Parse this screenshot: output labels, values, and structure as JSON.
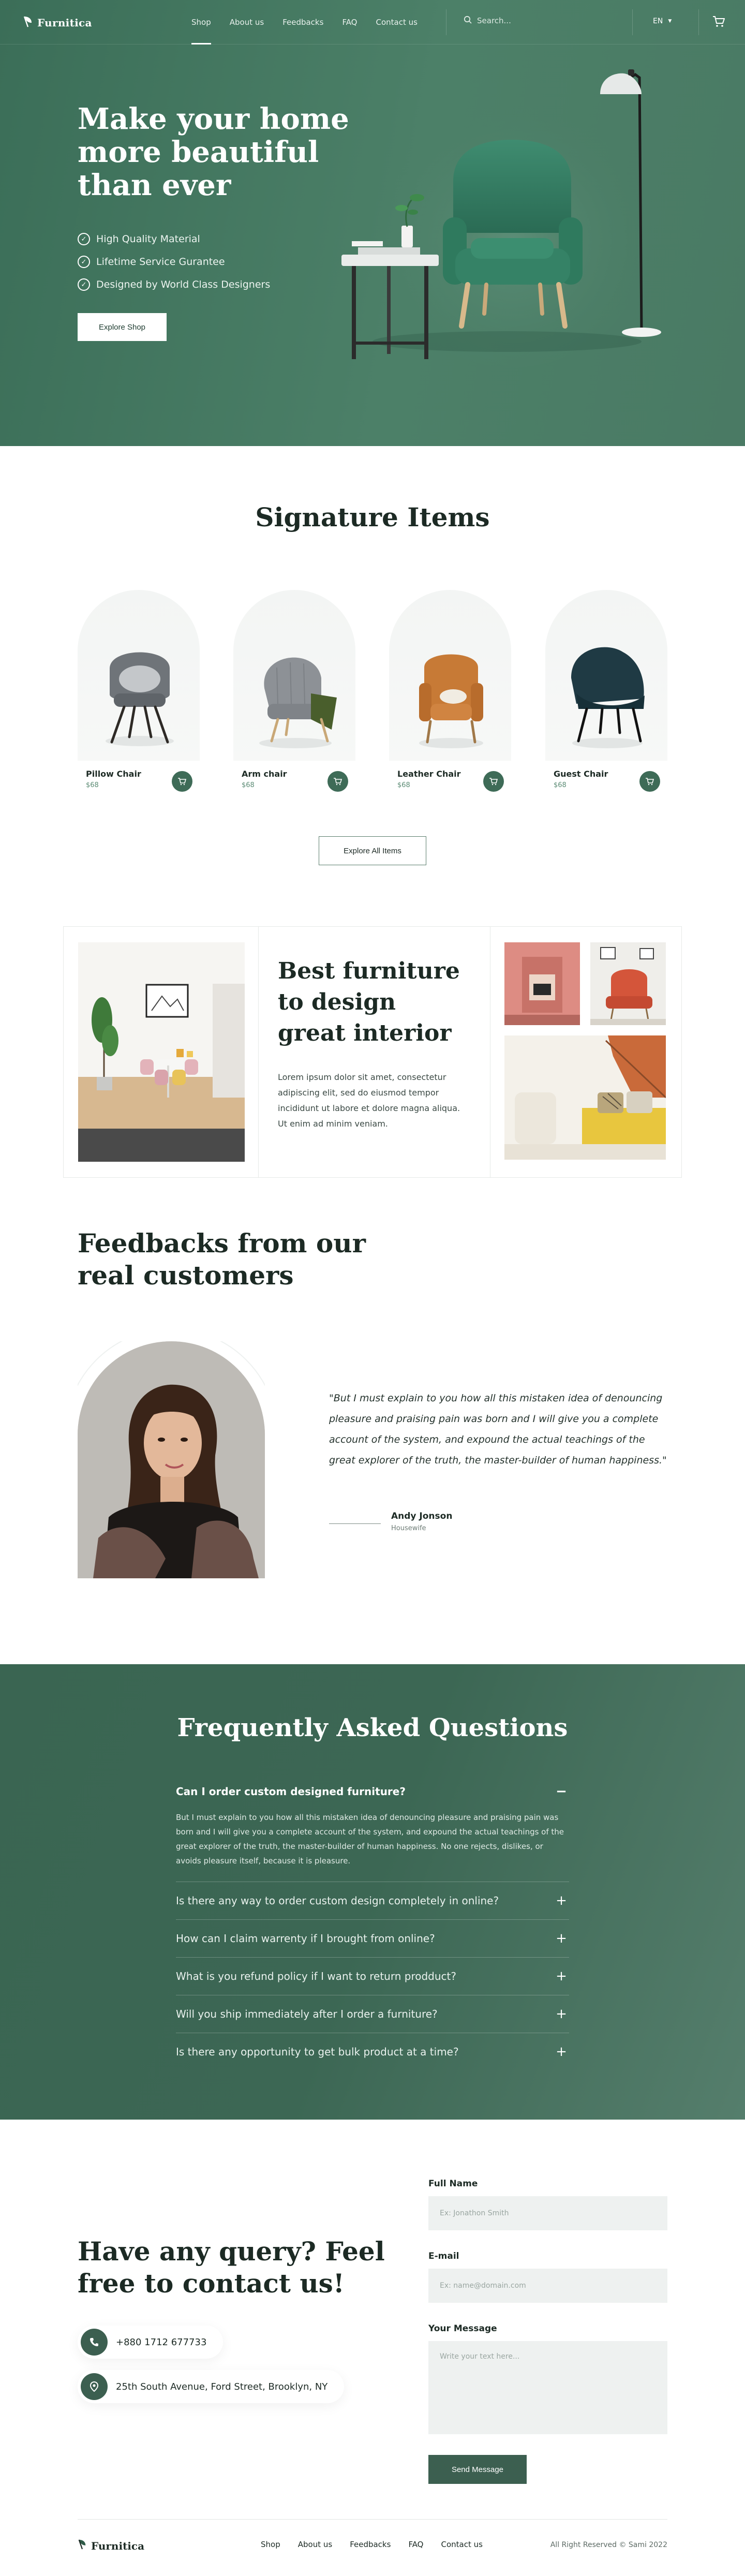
{
  "brand": {
    "name": "Furnitica",
    "copyright": "All Right Reserved © Sami 2022"
  },
  "nav": {
    "items": [
      {
        "label": "Shop",
        "active": true
      },
      {
        "label": "About us",
        "active": false
      },
      {
        "label": "Feedbacks",
        "active": false
      },
      {
        "label": "FAQ",
        "active": false
      },
      {
        "label": "Contact us",
        "active": false
      }
    ],
    "search_placeholder": "Search...",
    "language": "EN"
  },
  "hero": {
    "title": "Make your home more beautiful than ever",
    "features": [
      "High Quality Material",
      "Lifetime Service Gurantee",
      "Designed by World Class Designers"
    ],
    "cta": "Explore Shop"
  },
  "signature": {
    "title": "Signature Items",
    "products": [
      {
        "name": "Pillow Chair",
        "price": "$68",
        "color": "#6f7479"
      },
      {
        "name": "Arm chair",
        "price": "$68",
        "color": "#8d9196"
      },
      {
        "name": "Leather Chair",
        "price": "$68",
        "color": "#c77a36"
      },
      {
        "name": "Guest Chair",
        "price": "$68",
        "color": "#1f3a44"
      }
    ],
    "cta": "Explore All Items"
  },
  "best": {
    "title": "Best furniture to design great interior",
    "text": "Lorem ipsum dolor sit amet, consectetur adipiscing elit, sed do eiusmod tempor incididunt ut labore et dolore magna aliqua. Ut enim ad minim veniam."
  },
  "feedback": {
    "title": "Feedbacks from our real customers",
    "quote": "\"But I must explain to you how all this mistaken idea of denouncing pleasure and praising pain was born and I will give you a complete account of the system, and expound the actual teachings of the great explorer of the truth, the master-builder of human happiness.\"",
    "author": "Andy Jonson",
    "role": "Housewife"
  },
  "faq": {
    "title": "Frequently Asked Questions",
    "items": [
      {
        "q": "Can I order custom designed furniture?",
        "a": "But I must explain to you how all this mistaken idea of denouncing pleasure and praising pain was born and I will give you a complete account of the system, and expound the actual teachings of the great explorer of the truth, the master-builder of human happiness. No one rejects, dislikes, or avoids pleasure itself, because it is pleasure.",
        "open": true
      },
      {
        "q": "Is there any way to order custom design completely in online?",
        "open": false
      },
      {
        "q": "How can I claim warrenty if I brought from online?",
        "open": false
      },
      {
        "q": "What is you refund policy if I want to return prodduct?",
        "open": false
      },
      {
        "q": "Will you ship immediately after I order a furniture?",
        "open": false
      },
      {
        "q": "Is there any opportunity to get bulk product at a time?",
        "open": false
      }
    ]
  },
  "contact": {
    "title": "Have any query? Feel free to contact us!",
    "phone": "+880 1712 677733",
    "address": "25th South Avenue, Ford Street, Brooklyn, NY",
    "form": {
      "name_label": "Full Name",
      "name_placeholder": "Ex: Jonathon Smith",
      "email_label": "E-mail",
      "email_placeholder": "Ex: name@domain.com",
      "message_label": "Your Message",
      "message_placeholder": "Write your text here...",
      "submit": "Send Message"
    }
  }
}
